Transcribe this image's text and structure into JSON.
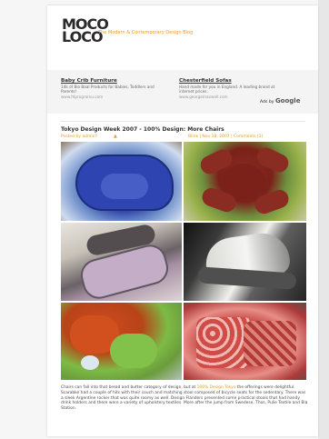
{
  "header": {
    "logo_line1": "MOCO",
    "logo_line2": "LOCO",
    "tagline": "The Modern & Contemporary Design Blog"
  },
  "ads": [
    {
      "title": "Baby Crib Furniture",
      "desc": "14k of Bio Baal Products for Babies, Toddlers and Parents!",
      "url": "www.fdprogramu.com"
    },
    {
      "title": "Chesterfield Sofas",
      "desc": "Hand made for you in England. A leading brand at internet prices.",
      "url": "www.georgemaxwell.com"
    }
  ],
  "ads_by": {
    "label": "Ads by",
    "brand": "Google"
  },
  "post": {
    "title": "Tokyo Design Week 2007 - 100% Design: More Chairs",
    "posted_by": "Posted by admin?",
    "links": "Blink | Nov 18, 2007 | Comments (1)",
    "body_before": "Chairs can fall into that bread and butter category of design, but at ",
    "body_link": "100% Design Tokyo",
    "body_after": " the offerings were delightful. Scarabke had a couple of hits with their couch and matching stool composed of bicycle seats for the sedentary. There was a sleek Argentine rocker that was quite roomy as well. Design Flanders presented some practical stools that had handy drink holders and there were a variety of upholstery textiles. More after the jump from Swedese, Thos, Pulie Textile and Bla Station."
  },
  "colors": {
    "accent": "#e89c1c",
    "text": "#4b4b4b"
  },
  "icons": [
    "user-icon"
  ]
}
